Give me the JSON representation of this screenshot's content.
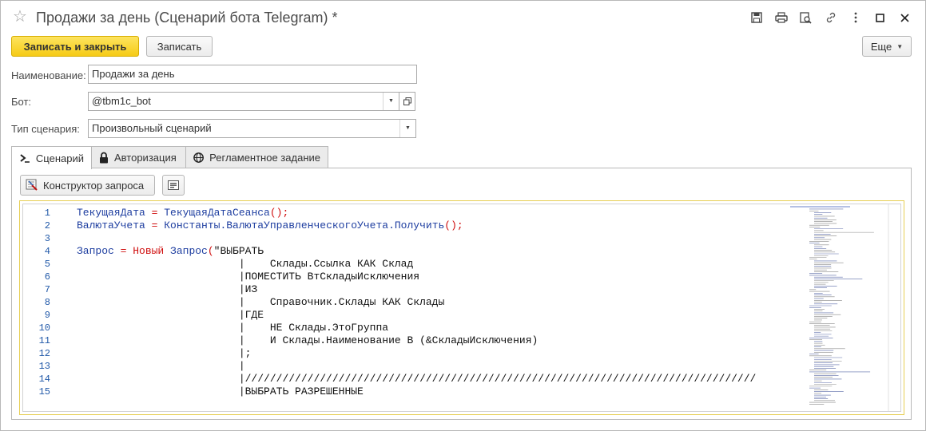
{
  "window": {
    "title": "Продажи за день (Сценарий бота Telegram) *"
  },
  "toolbar": {
    "save_close_label": "Записать и закрыть",
    "save_label": "Записать",
    "more_label": "Еще"
  },
  "form": {
    "name_label": "Наименование:",
    "name_value": "Продажи за день",
    "bot_label": "Бот:",
    "bot_value": "@tbm1c_bot",
    "type_label": "Тип сценария:",
    "type_value": "Произвольный сценарий"
  },
  "tabs": [
    {
      "label": "Сценарий",
      "icon": "terminal-icon",
      "active": true
    },
    {
      "label": "Авторизация",
      "icon": "lock-icon",
      "active": false
    },
    {
      "label": "Регламентное задание",
      "icon": "globe-icon",
      "active": false
    }
  ],
  "scenario": {
    "constructor_label": "Конструктор запроса"
  },
  "code": {
    "lines": [
      {
        "num": "1",
        "segments": [
          [
            "ident",
            "ТекущаяДата"
          ],
          [
            "op",
            " = "
          ],
          [
            "ident",
            "ТекущаяДатаСеанса"
          ],
          [
            "op",
            "();"
          ]
        ]
      },
      {
        "num": "2",
        "segments": [
          [
            "ident",
            "ВалютаУчета"
          ],
          [
            "op",
            " = "
          ],
          [
            "ident",
            "Константы.ВалютаУправленческогоУчета.Получить"
          ],
          [
            "op",
            "();"
          ]
        ]
      },
      {
        "num": "3",
        "segments": []
      },
      {
        "num": "4",
        "segments": [
          [
            "ident",
            "Запрос"
          ],
          [
            "op",
            " = "
          ],
          [
            "kw",
            "Новый"
          ],
          [
            "ident",
            " Запрос"
          ],
          [
            "op",
            "("
          ],
          [
            "str",
            "\"ВЫБРАТЬ"
          ]
        ]
      },
      {
        "num": "5",
        "segments": [
          [
            "str",
            "                          |    Склады.Ссылка КАК Склад"
          ]
        ]
      },
      {
        "num": "6",
        "segments": [
          [
            "str",
            "                          |ПОМЕСТИТЬ ВтСкладыИсключения"
          ]
        ]
      },
      {
        "num": "7",
        "segments": [
          [
            "str",
            "                          |ИЗ"
          ]
        ]
      },
      {
        "num": "8",
        "segments": [
          [
            "str",
            "                          |    Справочник.Склады КАК Склады"
          ]
        ]
      },
      {
        "num": "9",
        "segments": [
          [
            "str",
            "                          |ГДЕ"
          ]
        ]
      },
      {
        "num": "10",
        "segments": [
          [
            "str",
            "                          |    НЕ Склады.ЭтоГруппа"
          ]
        ]
      },
      {
        "num": "11",
        "segments": [
          [
            "str",
            "                          |    И Склады.Наименование В (&СкладыИсключения)"
          ]
        ]
      },
      {
        "num": "12",
        "segments": [
          [
            "str",
            "                          |;"
          ]
        ]
      },
      {
        "num": "13",
        "segments": [
          [
            "str",
            "                          |"
          ]
        ]
      },
      {
        "num": "14",
        "segments": [
          [
            "str",
            "                          |//////////////////////////////////////////////////////////////////////////////////"
          ]
        ]
      },
      {
        "num": "15",
        "segments": [
          [
            "str",
            "                          |ВЫБРАТЬ РАЗРЕШЕННЫЕ"
          ]
        ]
      }
    ]
  },
  "colors": {
    "primary_button": "#f6cb16",
    "line_number": "#2058a8",
    "identifier": "#1e3ea0",
    "keyword": "#d01010",
    "editor_focus": "#e7cf55"
  }
}
